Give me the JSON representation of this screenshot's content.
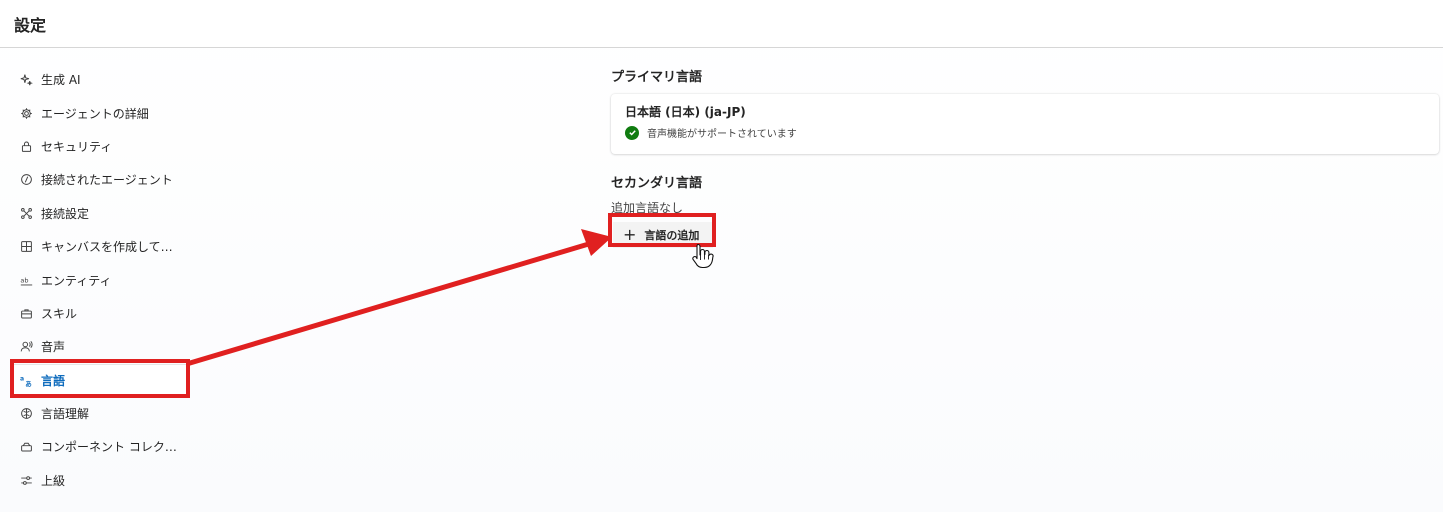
{
  "header": {
    "title": "設定"
  },
  "sidebar": {
    "items": [
      {
        "label": "生成 AI",
        "icon": "sparkle-icon"
      },
      {
        "label": "エージェントの詳細",
        "icon": "gear-icon"
      },
      {
        "label": "セキュリティ",
        "icon": "lock-icon"
      },
      {
        "label": "接続されたエージェント",
        "icon": "link-icon"
      },
      {
        "label": "接続設定",
        "icon": "connections-icon"
      },
      {
        "label": "キャンバスを作成して…",
        "icon": "grid-icon"
      },
      {
        "label": "エンティティ",
        "icon": "abc-icon"
      },
      {
        "label": "スキル",
        "icon": "briefcase-icon"
      },
      {
        "label": "音声",
        "icon": "voice-icon"
      },
      {
        "label": "言語",
        "icon": "translate-icon",
        "selected": true
      },
      {
        "label": "言語理解",
        "icon": "brain-icon"
      },
      {
        "label": "コンポーネント コレク…",
        "icon": "component-icon"
      },
      {
        "label": "上級",
        "icon": "sliders-icon"
      }
    ]
  },
  "primary": {
    "title": "プライマリ言語",
    "language": "日本語 (日本) (ja-JP)",
    "status": "音声機能がサポートされています",
    "status_icon": "check-circle-icon"
  },
  "secondary": {
    "title": "セカンダリ言語",
    "empty_text": "追加言語なし",
    "add_button": "言語の追加"
  },
  "colors": {
    "accent": "#0f6cbd",
    "highlight": "#e02020",
    "success": "#107c10"
  }
}
